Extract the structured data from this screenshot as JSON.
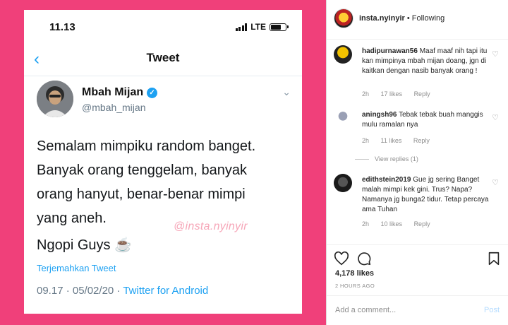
{
  "tweet_screenshot": {
    "status_bar": {
      "time": "11.13",
      "network": "LTE"
    },
    "nav": {
      "title": "Tweet"
    },
    "author": {
      "name": "Mbah Mijan",
      "handle": "@mbah_mijan"
    },
    "text_lines": [
      "Semalam mimpiku random banget.",
      "Banyak orang tenggelam, banyak",
      "orang hanyut,  benar-benar mimpi",
      "yang aneh."
    ],
    "text_last": "Ngopi Guys ☕",
    "watermark": "@insta.nyinyir",
    "translate": "Terjemahkan Tweet",
    "meta_time": "09.17 · 05/02/20 · ",
    "meta_source": "Twitter for Android"
  },
  "instagram": {
    "header": {
      "username": "insta.nyinyir",
      "follow_status": "Following"
    },
    "comments": [
      {
        "username": "hadipurnawan56",
        "text": "Maaf maaf nih tapi itu kan mimpinya mbah mijan doang, jgn di kaitkan dengan nasib banyak orang !",
        "age": "2h",
        "likes": "17 likes",
        "reply": "Reply"
      },
      {
        "username": "aningsh96",
        "text": "Tebak tebak buah manggis mulu ramalan nya",
        "age": "2h",
        "likes": "11 likes",
        "reply": "Reply",
        "view_replies": "View replies (1)"
      },
      {
        "username": "edithstein2019",
        "text": "Gue jg sering Banget malah mimpi kek gini. Trus? Napa? Namanya jg bunga2 tidur. Tetap percaya ama Tuhan",
        "age": "2h",
        "likes": "10 likes",
        "reply": "Reply"
      }
    ],
    "likes_count": "4,178 likes",
    "time_ago": "2 HOURS AGO",
    "add_comment_placeholder": "Add a comment...",
    "post_label": "Post"
  },
  "colors": {
    "pink_background": "#f0407a",
    "twitter_blue": "#1da1f2",
    "instagram_link_disabled": "#b3dbff"
  }
}
